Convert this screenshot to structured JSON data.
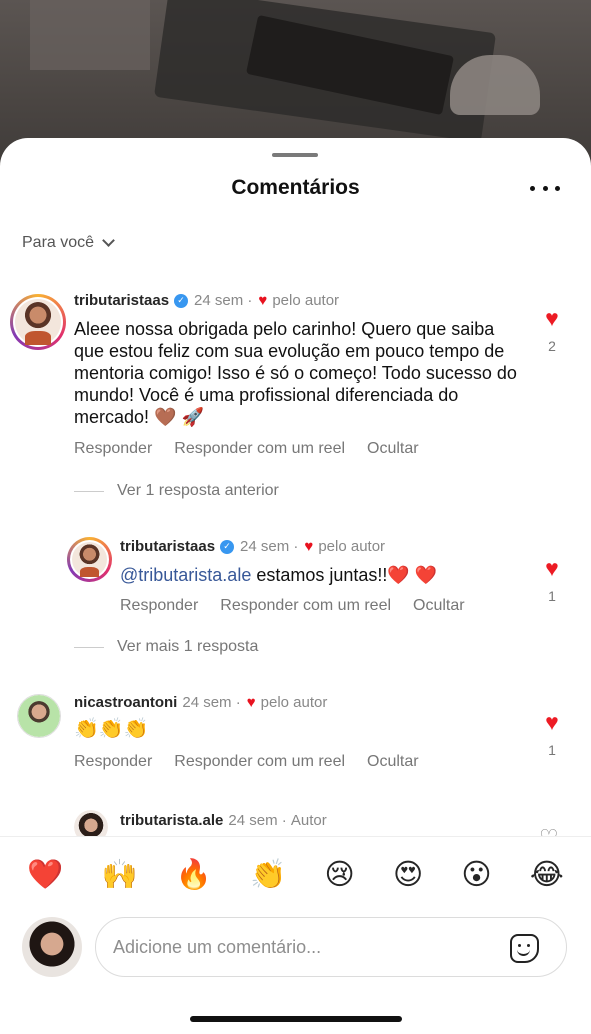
{
  "sheet": {
    "title": "Comentários"
  },
  "sort": {
    "label": "Para você"
  },
  "comments": [
    {
      "user": "tributaristaas",
      "time": "24 sem",
      "liked_by": "pelo autor",
      "text": "Aleee nossa obrigada pelo carinho! Quero que saiba que estou feliz com sua evolução em pouco tempo de mentoria comigo! Isso é só o começo! Todo sucesso do mundo! Você é uma profissional diferenciada do mercado! 🤎 🚀",
      "likes": "2",
      "actions": [
        "Responder",
        "Responder com um reel",
        "Ocultar"
      ],
      "thread_link": "Ver 1 resposta anterior"
    },
    {
      "user": "tributaristaas",
      "time": "24 sem",
      "liked_by": "pelo autor",
      "mention": "@tributarista.ale",
      "text": " estamos juntas!!❤️ ❤️",
      "likes": "1",
      "actions": [
        "Responder",
        "Responder com um reel",
        "Ocultar"
      ],
      "thread_link": "Ver mais 1 resposta"
    },
    {
      "user": "nicastroantoni",
      "time": "24 sem",
      "liked_by": "pelo autor",
      "text": "👏👏👏",
      "likes": "1",
      "actions": [
        "Responder",
        "Responder com um reel",
        "Ocultar"
      ]
    },
    {
      "user": "tributarista.ale",
      "time": "24 sem",
      "author_tag": "Autor"
    }
  ],
  "emoji_bar": [
    "❤️",
    "🙌",
    "🔥",
    "👏",
    "😢",
    "😍",
    "😮",
    "😂"
  ],
  "composer": {
    "placeholder": "Adicione um comentário..."
  },
  "colors": {
    "like": "#ed1b24",
    "verified": "#3897f0",
    "mention": "#385898"
  }
}
